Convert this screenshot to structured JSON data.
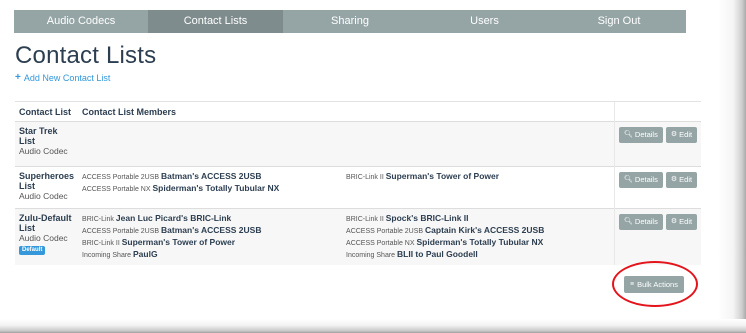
{
  "nav": {
    "items": [
      {
        "label": "Audio Codecs",
        "active": false
      },
      {
        "label": "Contact Lists",
        "active": true
      },
      {
        "label": "Sharing",
        "active": false
      },
      {
        "label": "Users",
        "active": false
      },
      {
        "label": "Sign Out",
        "active": false
      }
    ]
  },
  "page": {
    "title": "Contact Lists",
    "add_link": "Add New Contact List"
  },
  "table": {
    "headers": {
      "name": "Contact List",
      "members": "Contact List Members",
      "actions": ""
    },
    "rows": [
      {
        "name": "Star Trek List",
        "type": "Audio Codec",
        "badge": "",
        "members_left": [],
        "members_right": []
      },
      {
        "name": "Superheroes List",
        "type": "Audio Codec",
        "badge": "",
        "members_left": [
          {
            "prefix": "ACCESS Portable 2USB",
            "name": "Batman's ACCESS 2USB"
          },
          {
            "prefix": "ACCESS Portable NX",
            "name": "Spiderman's Totally Tubular NX"
          }
        ],
        "members_right": [
          {
            "prefix": "BRIC-Link II",
            "name": "Superman's Tower of Power"
          }
        ]
      },
      {
        "name": "Zulu-Default List",
        "type": "Audio Codec",
        "badge": "Default",
        "members_left": [
          {
            "prefix": "BRIC-Link",
            "name": "Jean Luc Picard's BRIC-Link"
          },
          {
            "prefix": "ACCESS Portable 2USB",
            "name": "Batman's ACCESS 2USB"
          },
          {
            "prefix": "BRIC-Link II",
            "name": "Superman's Tower of Power"
          },
          {
            "prefix": "Incoming Share",
            "name": "PaulG"
          }
        ],
        "members_right": [
          {
            "prefix": "BRIC-Link II",
            "name": "Spock's BRIC-Link II"
          },
          {
            "prefix": "ACCESS Portable 2USB",
            "name": "Captain Kirk's ACCESS 2USB"
          },
          {
            "prefix": "ACCESS Portable NX",
            "name": "Spiderman's Totally Tubular NX"
          },
          {
            "prefix": "Incoming Share",
            "name": "BLII to Paul Goodell"
          }
        ]
      }
    ],
    "details_label": "Details",
    "edit_label": "Edit"
  },
  "bulk": {
    "label": "Bulk Actions"
  },
  "icons": {
    "add": "plus-icon",
    "details": "search-plus-icon",
    "edit": "gears-icon",
    "bulk": "list-icon"
  },
  "colors": {
    "nav_bg": "#95a5a6",
    "nav_active": "#7f8c8d",
    "link": "#3498db",
    "title": "#2c3e50",
    "button": "#95a5a6",
    "highlight_ring": "#e3141b"
  }
}
